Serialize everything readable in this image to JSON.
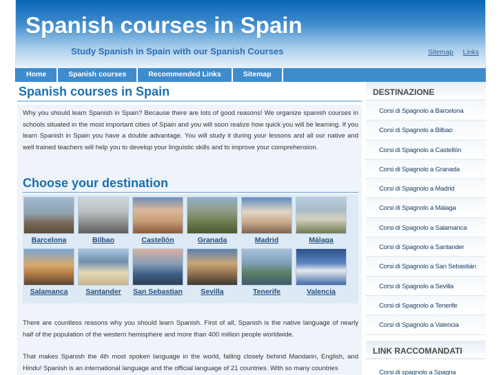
{
  "header": {
    "title": "Spanish courses in Spain",
    "tagline": "Study Spanish in Spain with our Spanish Courses",
    "links": [
      "Sitemap",
      "Links"
    ]
  },
  "nav": [
    "Home",
    "Spanish courses",
    "Recommended Links",
    "Sitemap"
  ],
  "main": {
    "title": "Spanish courses in Spain",
    "intro": "Why you should learn Spanish in Spain? Because there are lots of good reasons! We organize spanish courses in schools situated in the most important cities of Spain and you will soon realize how quick you will be learning. If you learn Spanish in Spain you have a double advantage. You will study it during your lessons and all our native and well trained teachers will help you to develop your linguistic skills and to improve your comprehension.",
    "destinations_title": "Choose your destination",
    "destinations": [
      "Barcelona",
      "Bilbao",
      "Castellón",
      "Granada",
      "Madrid",
      "Málaga",
      "Salamanca",
      "Santander",
      "San Sebastian",
      "Sevilla",
      "Tenerife",
      "Valencia"
    ],
    "paragraph2": "There are countless reasons why you should learn Spanish. First of all, Spanish is the native language of nearly half of the population of the western hemisphere and more than 400 million people worldwide.",
    "paragraph3": "That makes Spanish the 4th most spoken language in the world, falling closely behind Mandarin, English, and Hindu! Spanish is an international language and the official language of 21 countries. With so many countries"
  },
  "sidebar": {
    "heading1": "DESTINAZIONE",
    "items": [
      "Corsi di Spagnolo a Barcelona",
      "Corsi di Spagnolo a Bilbao",
      "Corsi di Spagnolo a Castellón",
      "Corsi di Spagnolo a Granada",
      "Corsi di Spagnolo a Madrid",
      "Corsi di Spagnolo a Málaga",
      "Corsi di Spagnolo a Salamanca",
      "Corsi di Spagnolo a Santander",
      "Corsi di Spagnolo a San Sebastián",
      "Corsi di Spagnolo a Sevilla",
      "Corsi di Spagnolo a Tenerife",
      "Corsi di Spagnolo a Valencia"
    ],
    "heading2": "LINK RACCOMANDATI",
    "items2": [
      "Corsi di spagnolo a Spagna"
    ]
  },
  "colors": {
    "header_blue": "#0a66b6",
    "nav_blue": "#3f8ccd",
    "title_blue": "#1b6fae",
    "content_bg": "#eef4fa"
  }
}
